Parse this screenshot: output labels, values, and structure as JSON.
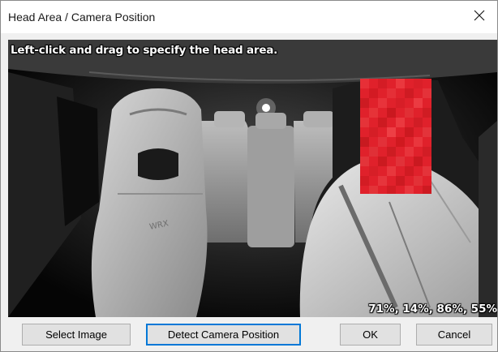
{
  "window": {
    "title": "Head Area / Camera Position",
    "close_icon": "close-icon"
  },
  "viewer": {
    "instruction": "Left-click and drag to specify the head area.",
    "head_area_coords": "71%, 14%, 86%, 55%",
    "head_area_color": "#e0212b"
  },
  "buttons": {
    "select_image": "Select Image",
    "detect_camera": "Detect Camera Position",
    "ok": "OK",
    "cancel": "Cancel"
  }
}
